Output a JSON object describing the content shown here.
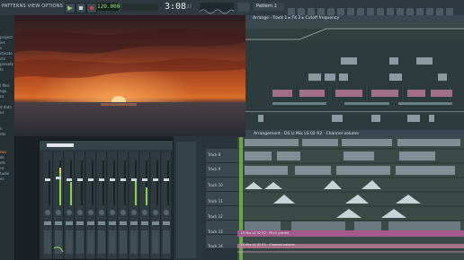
{
  "toolbar": {
    "menu": "PATTERNS VIEW OPTIONS TOOLS HELP",
    "tempo": "120.000",
    "time": "3:08",
    "time_sub": "27",
    "pattern": "Pattern 1",
    "icons": [
      "play-icon",
      "stop-icon",
      "record-icon"
    ]
  },
  "browser": {
    "items": [
      "project",
      "ies",
      "s",
      "ctivate",
      "cts",
      "presets",
      "ts",
      "",
      "I files",
      "ngs",
      "ns",
      "",
      "d data",
      "es",
      "",
      "n",
      "nts",
      "",
      "nes",
      "ds",
      "ots",
      "ns",
      "tudio",
      "es"
    ],
    "active_item": "nes"
  },
  "playlist": {
    "title": "Arrange · Track 1 ▸ FX 2 ▸ Cutoff frequency",
    "title2": "Arrangement · DS LI Mix LS 02 R2 · Channel volume",
    "tracks": [
      "Track 8",
      "Track 9",
      "Track 10",
      "Track 11",
      "Track 12",
      "Track 13",
      "Track 14"
    ],
    "automation_clip": "LS Mix LS 02 R2 · Pitch (cents)",
    "automation_clip2": "LS Mix LS 02 R2 · Channel volume"
  },
  "colors": {
    "accent": "#ff8c3a",
    "meter": "#8bd24d",
    "lane": "#3d4c48"
  }
}
